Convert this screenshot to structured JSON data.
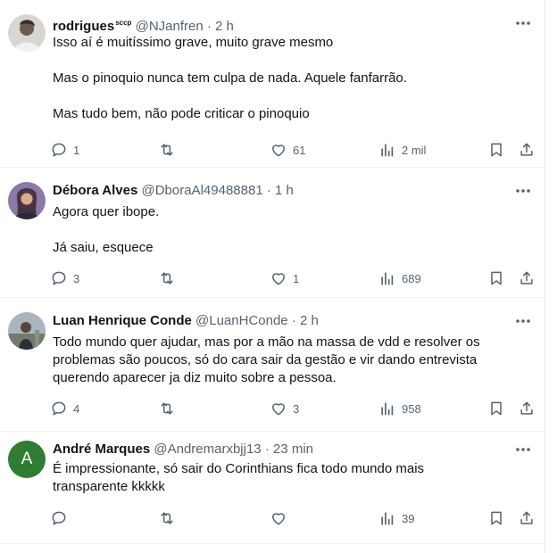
{
  "tweets": [
    {
      "name": "rodrigues",
      "badge": "sccp",
      "handle": "@NJanfren",
      "sep": "·",
      "time": "2 h",
      "avatar_icon": "person-photo-icon",
      "lines": [
        "Isso aí é muitíssimo grave, muito grave mesmo",
        "Mas o pinoquio nunca tem culpa de nada. Aquele fanfarrão.",
        "Mas tudo bem, não pode criticar o pinoquio"
      ],
      "replies": "1",
      "retweets": "",
      "likes": "61",
      "views": "2 mil"
    },
    {
      "name": "Débora Alves",
      "badge": "",
      "handle": "@DboraAl49488881",
      "sep": "·",
      "time": "1 h",
      "avatar_icon": "person-photo-icon",
      "lines": [
        "Agora quer ibope.",
        "Já saiu, esquece"
      ],
      "replies": "3",
      "retweets": "",
      "likes": "1",
      "views": "689"
    },
    {
      "name": "Luan Henrique Conde",
      "badge": "",
      "handle": "@LuanHConde",
      "sep": "·",
      "time": "2 h",
      "avatar_icon": "person-photo-icon",
      "lines": [
        "Todo mundo quer ajudar, mas por a mão na massa de vdd e resolver os",
        "problemas são poucos, só do cara sair da gestão e vir dando entrevista",
        "querendo aparecer ja diz muito sobre a pessoa."
      ],
      "replies": "4",
      "retweets": "",
      "likes": "3",
      "views": "958"
    },
    {
      "name": "André Marques",
      "badge": "",
      "handle": "@Andremarxbjj13",
      "sep": "·",
      "time": "23 min",
      "avatar_letter": "A",
      "lines": [
        "É impressionante, só sair do Corinthians fica todo mundo mais",
        "transparente kkkkk"
      ],
      "replies": "",
      "retweets": "",
      "likes": "",
      "views": "39"
    }
  ],
  "colors": {
    "text": "#0f1419",
    "secondary": "#536471",
    "divider": "#eff3f4",
    "avatar_green": "#2e7d32"
  }
}
